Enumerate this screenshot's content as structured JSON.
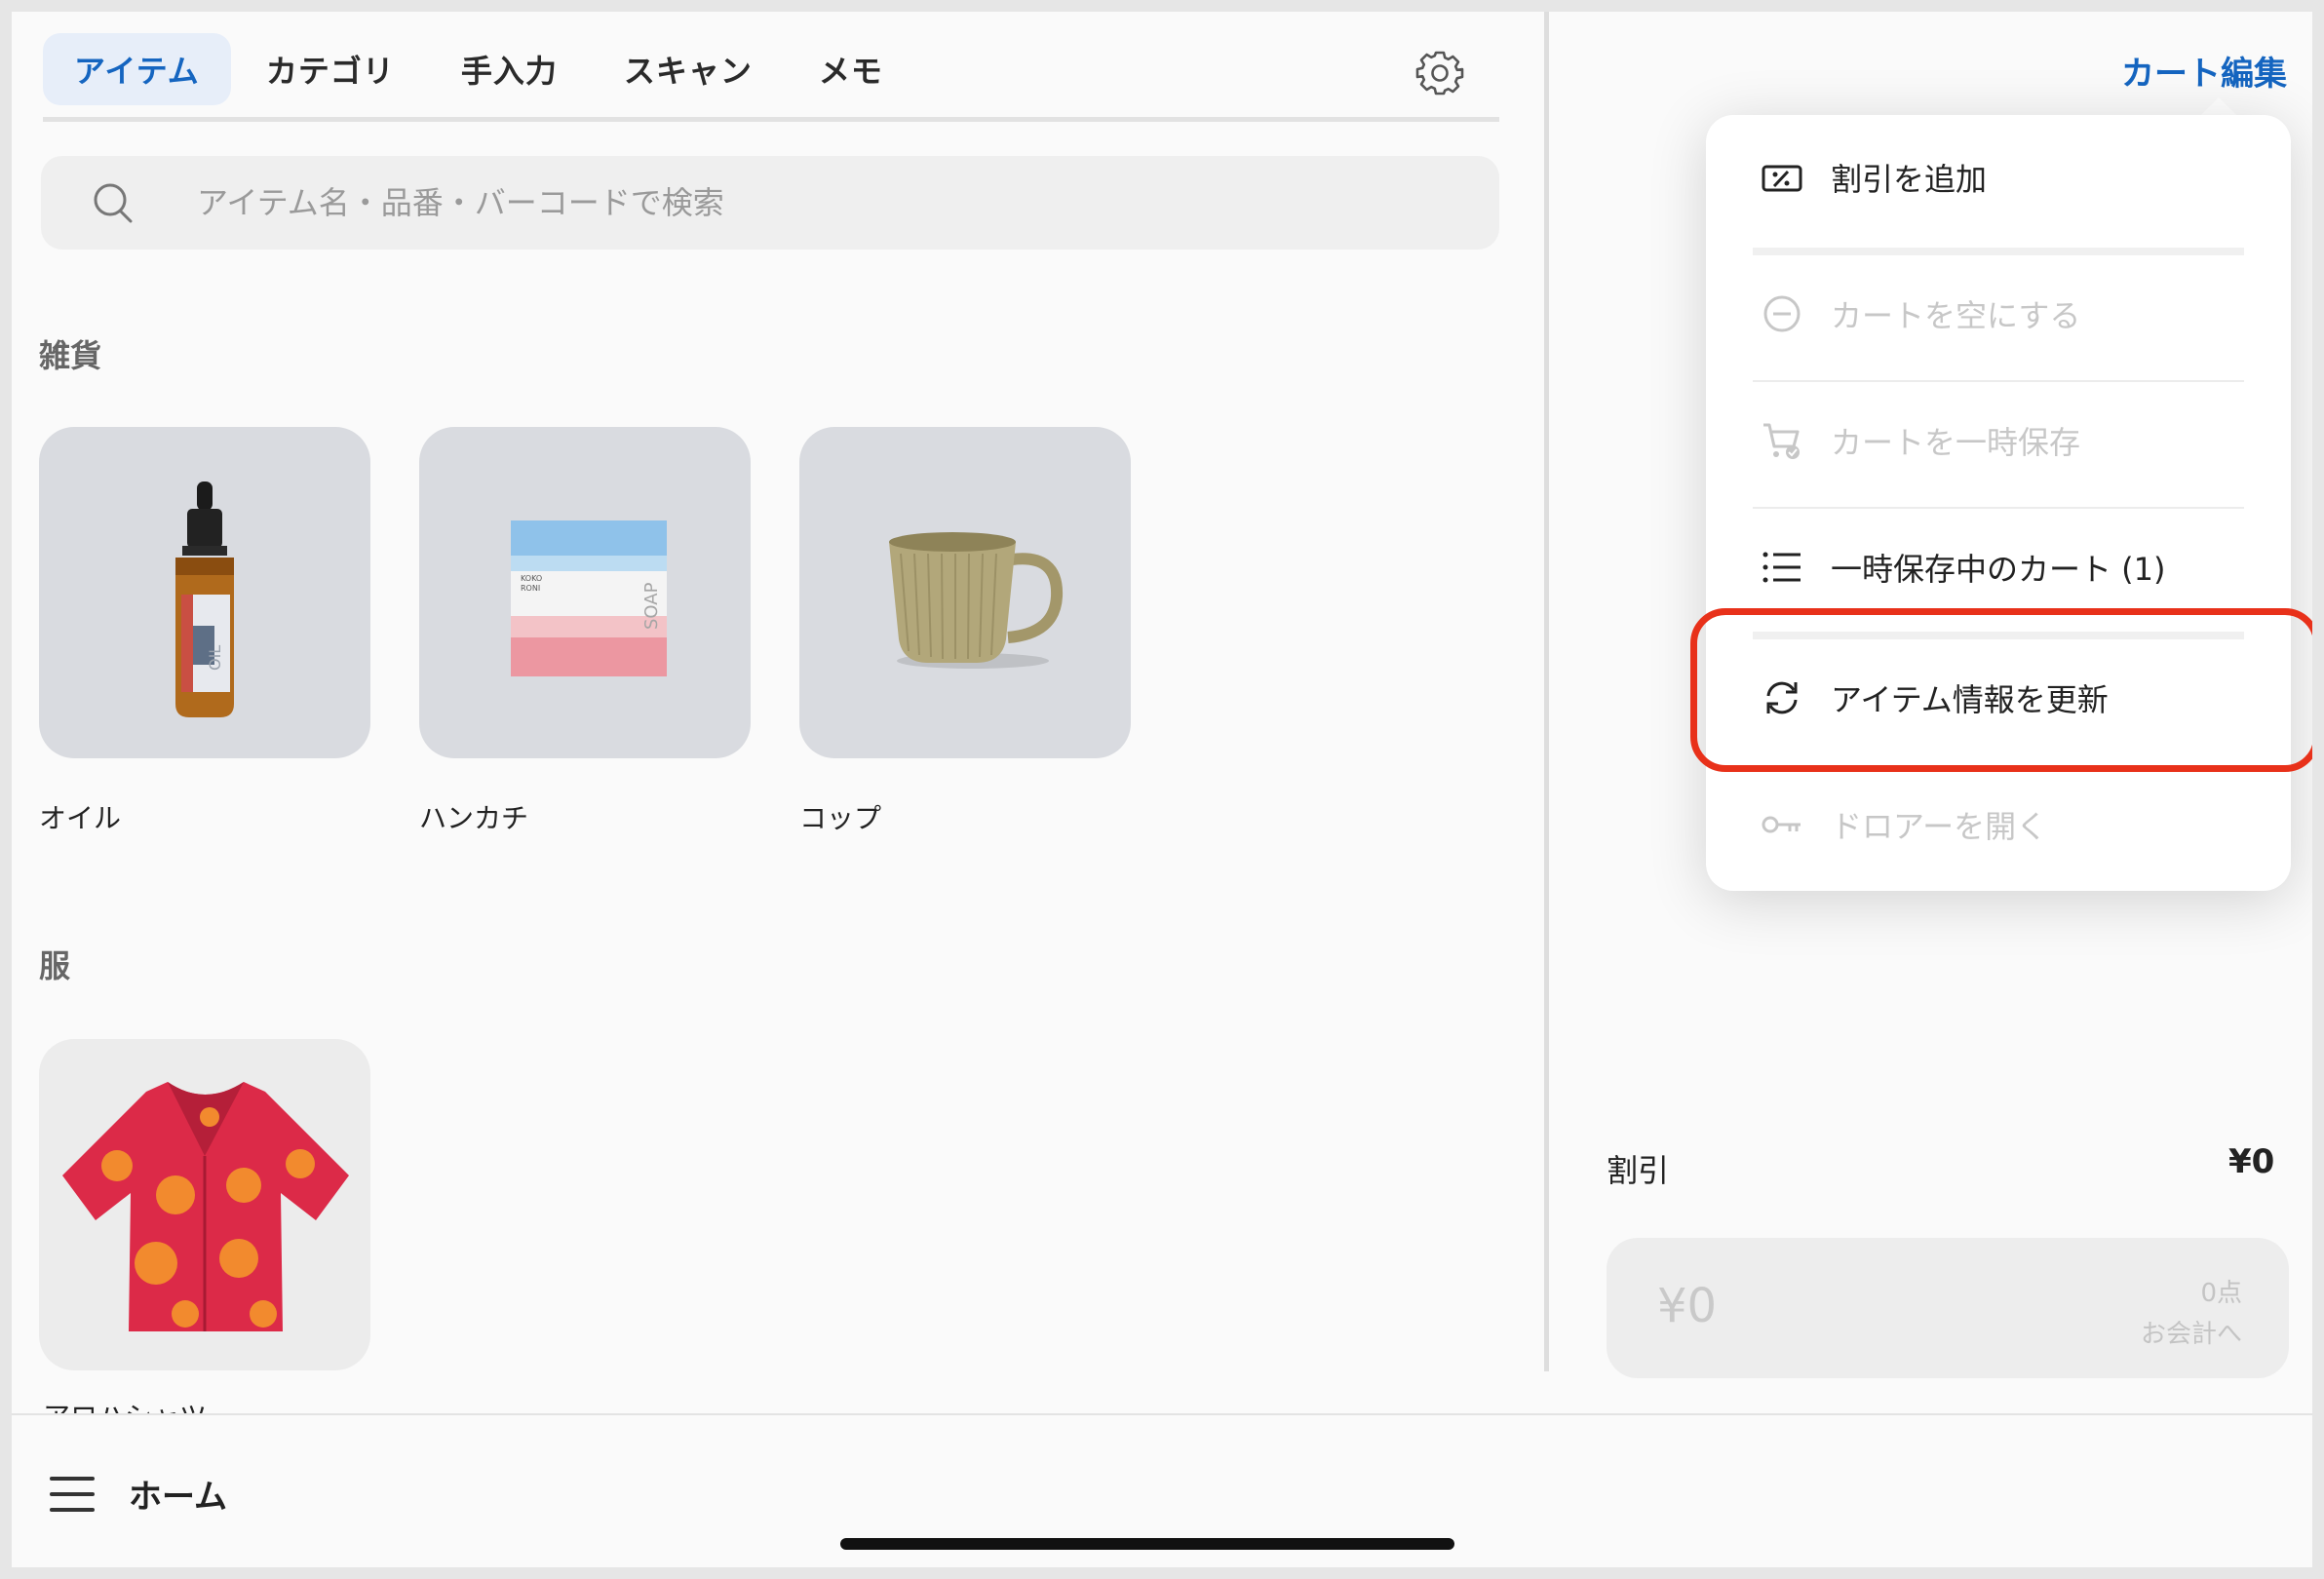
{
  "tabs": [
    {
      "label": "アイテム",
      "active": true
    },
    {
      "label": "カテゴリ",
      "active": false
    },
    {
      "label": "手入力",
      "active": false
    },
    {
      "label": "スキャン",
      "active": false
    },
    {
      "label": "メモ",
      "active": false
    }
  ],
  "search": {
    "placeholder": "アイテム名・品番・バーコードで検索",
    "value": ""
  },
  "sections": [
    {
      "title": "雑貨",
      "items": [
        {
          "name": "オイル",
          "icon": "oil-bottle"
        },
        {
          "name": "ハンカチ",
          "icon": "soap-bar"
        },
        {
          "name": "コップ",
          "icon": "cup"
        }
      ]
    },
    {
      "title": "服",
      "items": [
        {
          "name": "アロハシャツ",
          "icon": "aloha-shirt"
        }
      ]
    }
  ],
  "bottom_bar": {
    "home_label": "ホーム"
  },
  "cart": {
    "edit_label": "カート編集",
    "menu": [
      {
        "label": "割引を追加",
        "icon": "discount-icon",
        "enabled": true
      },
      {
        "label": "カートを空にする",
        "icon": "minus-circle-icon",
        "enabled": false
      },
      {
        "label": "カートを一時保存",
        "icon": "cart-check-icon",
        "enabled": false
      },
      {
        "label": "一時保存中のカート (1)",
        "icon": "list-icon",
        "enabled": true
      },
      {
        "label": "アイテム情報を更新",
        "icon": "refresh-icon",
        "enabled": true,
        "highlighted": true
      },
      {
        "label": "ドロアーを開く",
        "icon": "key-icon",
        "enabled": false
      }
    ],
    "discount_label": "割引",
    "discount_value": "¥0",
    "checkout_total": "¥0",
    "checkout_count": "0点",
    "checkout_label": "お会計へ"
  },
  "colors": {
    "accent": "#1565c0",
    "highlight": "#e8311a",
    "active_tab_bg": "#e7eef9"
  }
}
